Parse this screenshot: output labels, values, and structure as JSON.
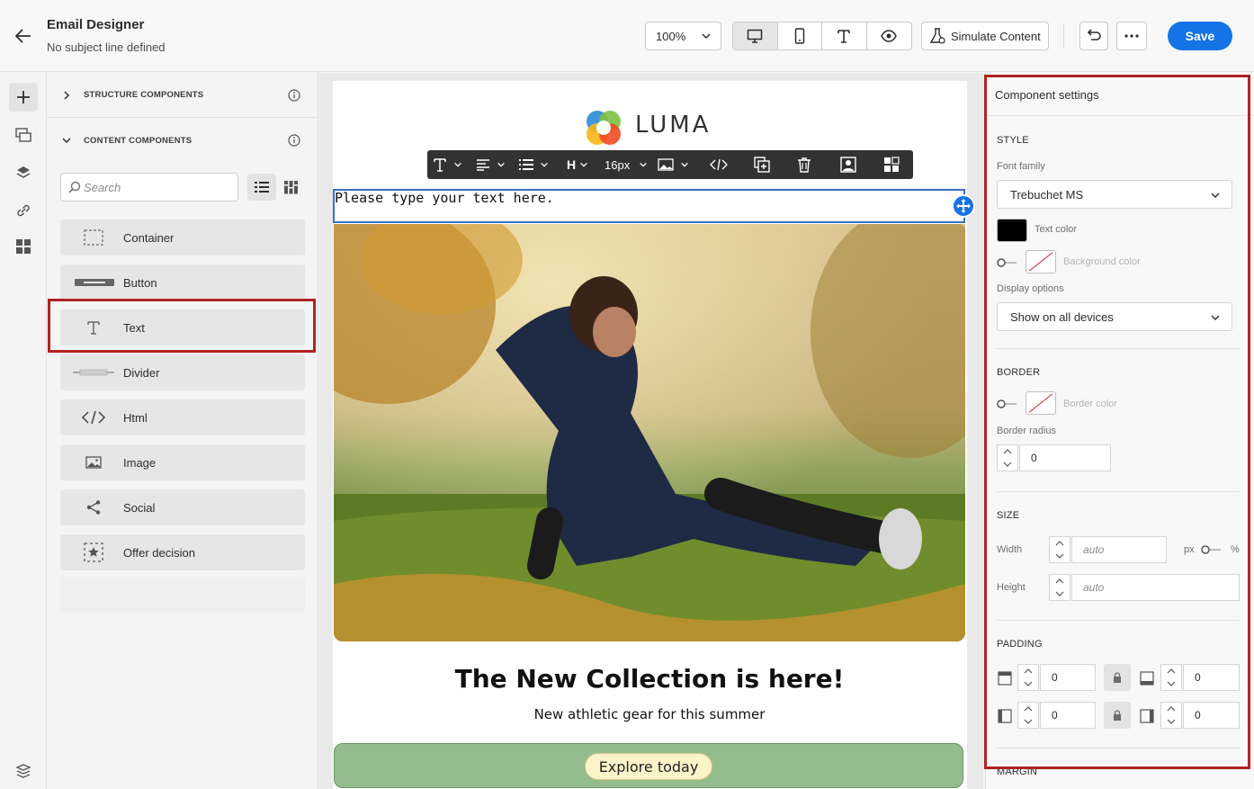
{
  "header": {
    "title": "Email Designer",
    "subtitle": "No subject line defined",
    "zoom": "100%",
    "simulate_label": "Simulate Content",
    "save_label": "Save",
    "view_icons": [
      "desktop-icon",
      "mobile-icon",
      "text-icon",
      "preview-icon"
    ]
  },
  "components_panel": {
    "structure_label": "STRUCTURE COMPONENTS",
    "content_label": "CONTENT COMPONENTS",
    "search_placeholder": "Search",
    "items": [
      {
        "label": "Container",
        "icon": "container-icon"
      },
      {
        "label": "Button",
        "icon": "button-icon"
      },
      {
        "label": "Text",
        "icon": "text-icon"
      },
      {
        "label": "Divider",
        "icon": "divider-icon"
      },
      {
        "label": "Html",
        "icon": "html-icon"
      },
      {
        "label": "Image",
        "icon": "image-icon"
      },
      {
        "label": "Social",
        "icon": "share-icon"
      },
      {
        "label": "Offer decision",
        "icon": "offer-decision-icon"
      }
    ]
  },
  "canvas": {
    "logo_text": "LUMA",
    "toolbar": {
      "font_size": "16px",
      "heading": "H"
    },
    "text_block": "Please type your text here.",
    "headline": "The New Collection is here!",
    "subline": "New athletic gear for this summer",
    "cta_label": "Explore today",
    "colors": {
      "cta_band": "#93bd8c",
      "cta_button": "#fcf3c9",
      "selection": "#3b6fc6"
    }
  },
  "settings": {
    "title": "Component settings",
    "style_heading": "STYLE",
    "font_family_label": "Font family",
    "font_family_value": "Trebuchet MS",
    "text_color_label": "Text color",
    "text_color_value": "#000000",
    "background_color_label": "Background color",
    "display_options_label": "Display options",
    "display_options_value": "Show on all devices",
    "border_heading": "BORDER",
    "border_color_label": "Border color",
    "border_radius_label": "Border radius",
    "border_radius_value": "0",
    "size_heading": "SIZE",
    "width_label": "Width",
    "width_placeholder": "auto",
    "unit_px": "px",
    "unit_pct": "%",
    "height_label": "Height",
    "height_placeholder": "auto",
    "padding_heading": "PADDING",
    "padding_top": "0",
    "padding_bottom": "0",
    "padding_left": "0",
    "padding_right": "0",
    "margin_heading": "MARGIN"
  },
  "accent_color": "#1473e6",
  "highlight_color": "#b22222"
}
